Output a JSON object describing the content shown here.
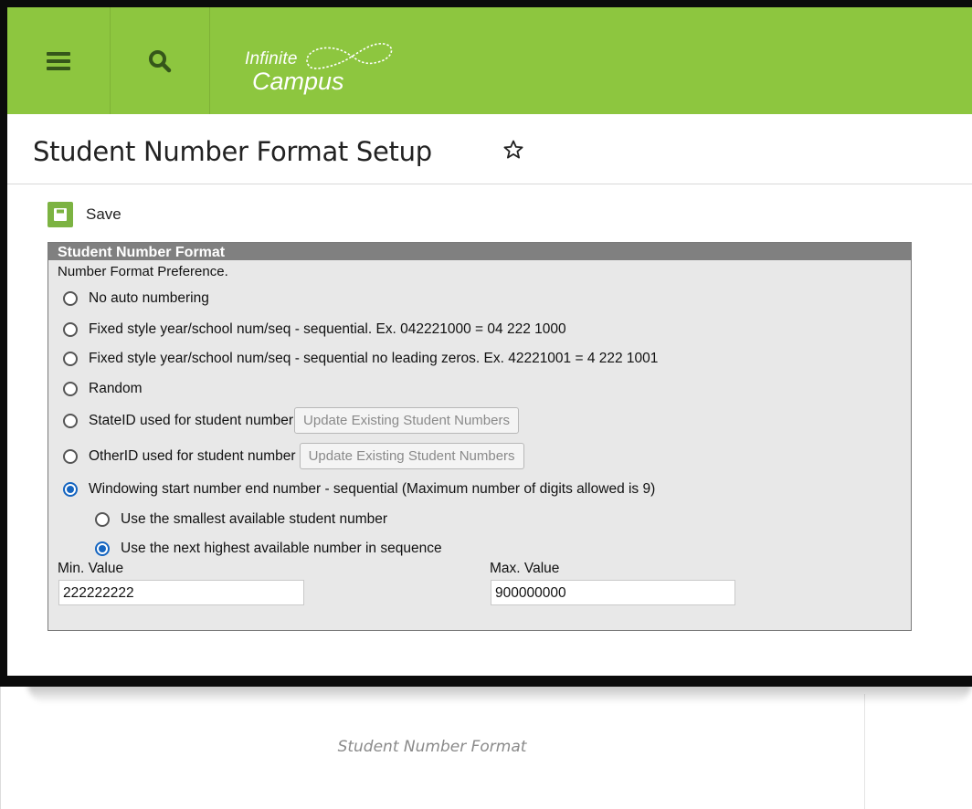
{
  "brand": {
    "line1": "Infinite",
    "line2": "Campus"
  },
  "colors": {
    "header_green": "#8dc63f",
    "save_green": "#7cb342",
    "radio_blue": "#1565c0"
  },
  "icons": {
    "menu": "hamburger-menu-icon",
    "search": "search-icon",
    "favorite": "star-outline-icon",
    "save": "floppy-disk-icon"
  },
  "page": {
    "title": "Student Number Format Setup"
  },
  "toolbar": {
    "save_label": "Save"
  },
  "panel": {
    "header": "Student Number Format",
    "preference_label": "Number Format Preference.",
    "options": [
      {
        "label": "No auto numbering",
        "selected": false
      },
      {
        "label": "Fixed style year/school num/seq - sequential. Ex. 042221000 = 04 222 1000",
        "selected": false
      },
      {
        "label": "Fixed style year/school num/seq - sequential no leading zeros. Ex. 42221001 = 4 222 1001",
        "selected": false
      },
      {
        "label": "Random",
        "selected": false
      },
      {
        "label": "StateID used for student number",
        "selected": false,
        "button": "Update Existing Student Numbers"
      },
      {
        "label": "OtherID used for student number",
        "selected": false,
        "button": "Update Existing Student Numbers"
      },
      {
        "label": "Windowing start number end number - sequential (Maximum number of digits allowed is 9)",
        "selected": true
      }
    ],
    "sub_options": [
      {
        "label": "Use the smallest available student number",
        "selected": false
      },
      {
        "label": "Use the next highest available number in sequence",
        "selected": true
      }
    ],
    "min_label": "Min. Value",
    "min_value": "222222222",
    "max_label": "Max. Value",
    "max_value": "900000000"
  },
  "caption": "Student Number Format"
}
